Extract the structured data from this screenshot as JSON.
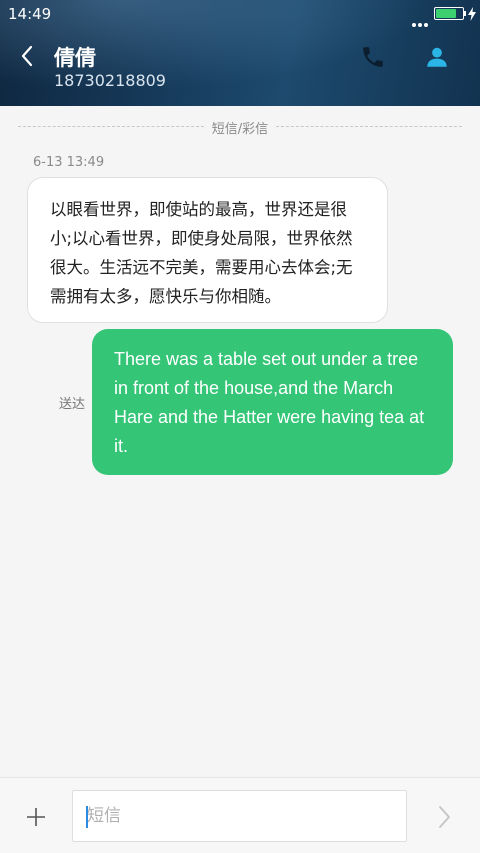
{
  "status_bar": {
    "time": "14:49",
    "battery_level": 0.72,
    "battery_color": "#3cd070"
  },
  "header": {
    "contact_name": "倩倩",
    "phone_number": "18730218809",
    "icons": [
      "back-arrow-icon",
      "phone-icon",
      "contact-icon"
    ]
  },
  "thread": {
    "divider_label": "短信/彩信",
    "timestamp": "6-13 13:49",
    "incoming_message": "以眼看世界，即使站的最高，世界还是很小;以心看世界，即使身处局限，世界依然很大。生活远不完美，需要用心去体会;无需拥有太多，愿快乐与你相随。",
    "outgoing_message": "There was a table set out under a tree in front of the house,and the March Hare and the Hatter were having tea at it.",
    "sent_status": "送达"
  },
  "composer": {
    "placeholder": "短信",
    "value": ""
  },
  "colors": {
    "outgoing_bubble": "#34c577",
    "accent": "#2bb5e6"
  }
}
